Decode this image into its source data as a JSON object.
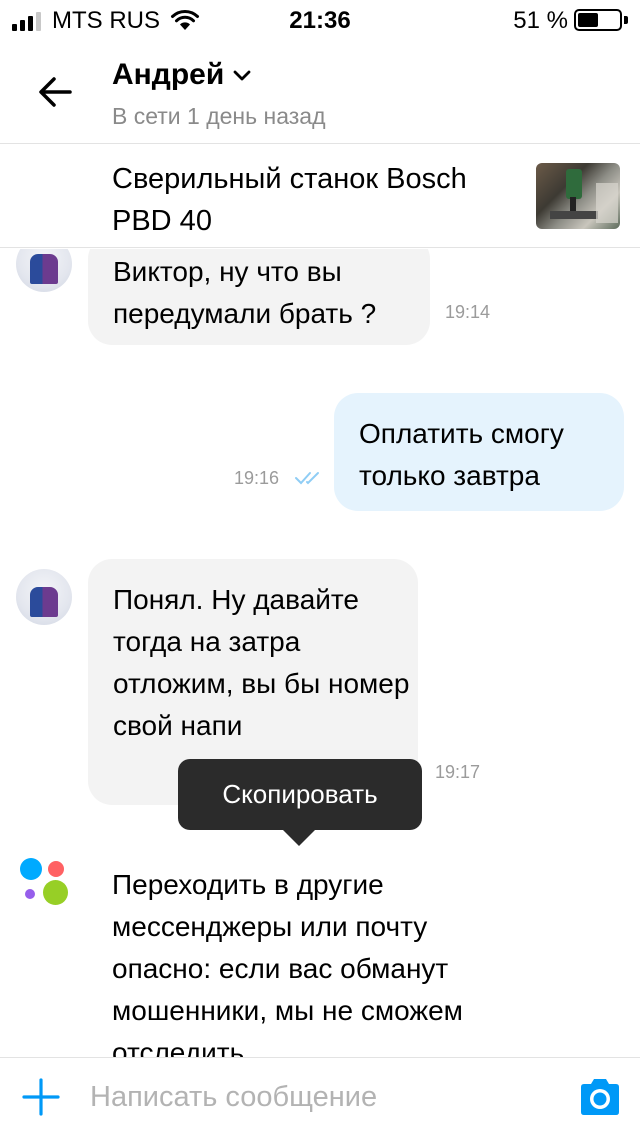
{
  "status_bar": {
    "carrier": "MTS RUS",
    "time": "21:36",
    "battery_percent": "51 %",
    "battery_level": 0.51
  },
  "header": {
    "contact_name": "Андрей",
    "contact_status": "В сети 1 день назад",
    "icons": [
      "back-arrow-icon",
      "chevron-down-icon"
    ]
  },
  "item": {
    "title": "Сверильный станок Bosch PBD 40"
  },
  "messages": [
    {
      "direction": "incoming",
      "text": "Виктор, ну что вы передумали брать ?",
      "time": "19:14"
    },
    {
      "direction": "outgoing",
      "text": "Оплатить смогу только завтра",
      "time": "19:16",
      "read": true
    },
    {
      "direction": "incoming",
      "text": "Понял. Ну давайте тогда на затра отложим, вы бы номер свой напи",
      "time": "19:17"
    }
  ],
  "tooltip": {
    "label": "Скопировать"
  },
  "system_message": {
    "text": "Переходить в другие мессенджеры или почту опасно: если вас обманут мошенники, мы не сможем отследить"
  },
  "composer": {
    "placeholder": "Написать сообщение",
    "value": "",
    "icons": [
      "plus-icon",
      "camera-icon"
    ]
  },
  "colors": {
    "accent": "#0099f7",
    "incoming_bubble": "#f3f3f3",
    "outgoing_bubble": "#e5f3fd",
    "tooltip_bg": "#2b2b2b",
    "logo_blue": "#00aaff",
    "logo_red": "#ff6163",
    "logo_purple": "#965eeb",
    "logo_green": "#97cf26"
  }
}
